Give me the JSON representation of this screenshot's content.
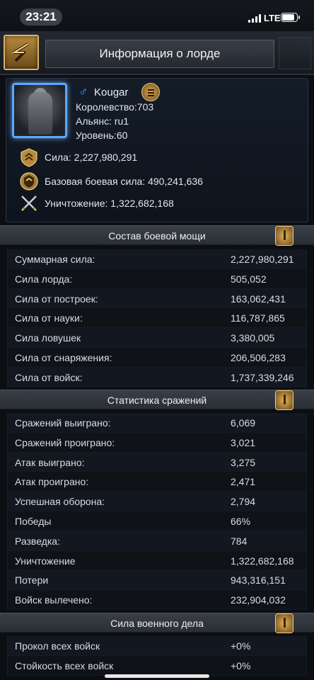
{
  "status_bar": {
    "time": "23:21",
    "network": "LTE",
    "battery_level": 0.9
  },
  "header": {
    "title": "Информация о лорде"
  },
  "lord": {
    "gender_symbol": "♂",
    "name": "Kougar",
    "kingdom": "Королевство:703",
    "alliance": "Альянс: ru1",
    "level": "Уровень:60",
    "power": "Сила: 2,227,980,291",
    "base_combat_power": "Базовая боевая сила: 490,241,636",
    "kills": "Уничтожение: 1,322,682,168"
  },
  "sections": [
    {
      "title": "Состав боевой мощи",
      "rows": [
        {
          "label": "Суммарная сила:",
          "value": "2,227,980,291"
        },
        {
          "label": "Сила лорда:",
          "value": "505,052"
        },
        {
          "label": "Сила от построек:",
          "value": "163,062,431"
        },
        {
          "label": "Сила от науки:",
          "value": "116,787,865"
        },
        {
          "label": "Сила ловушек",
          "value": "3,380,005"
        },
        {
          "label": "Сила от снаряжения:",
          "value": "206,506,283"
        },
        {
          "label": "Сила от войск:",
          "value": "1,737,339,246"
        }
      ]
    },
    {
      "title": "Статистика сражений",
      "rows": [
        {
          "label": "Сражений выиграно:",
          "value": "6,069"
        },
        {
          "label": "Сражений проиграно:",
          "value": "3,021"
        },
        {
          "label": "Атак выиграно:",
          "value": "3,275"
        },
        {
          "label": "Атак проиграно:",
          "value": "2,471"
        },
        {
          "label": "Успешная оборона:",
          "value": "2,794"
        },
        {
          "label": "Победы",
          "value": "66%"
        },
        {
          "label": "Разведка:",
          "value": "784"
        },
        {
          "label": "Уничтожение",
          "value": "1,322,682,168"
        },
        {
          "label": "Потери",
          "value": "943,316,151"
        },
        {
          "label": "Войск вылечено:",
          "value": "232,904,032"
        }
      ]
    },
    {
      "title": "Сила военного дела",
      "rows": [
        {
          "label": "Прокол всех войск",
          "value": "+0%"
        },
        {
          "label": "Стойкость всех войск",
          "value": "+0%"
        }
      ]
    }
  ],
  "colors": {
    "accent_gold": "#d9b36a",
    "avatar_frame": "#5ea7ff",
    "background": "#0b0e13"
  }
}
